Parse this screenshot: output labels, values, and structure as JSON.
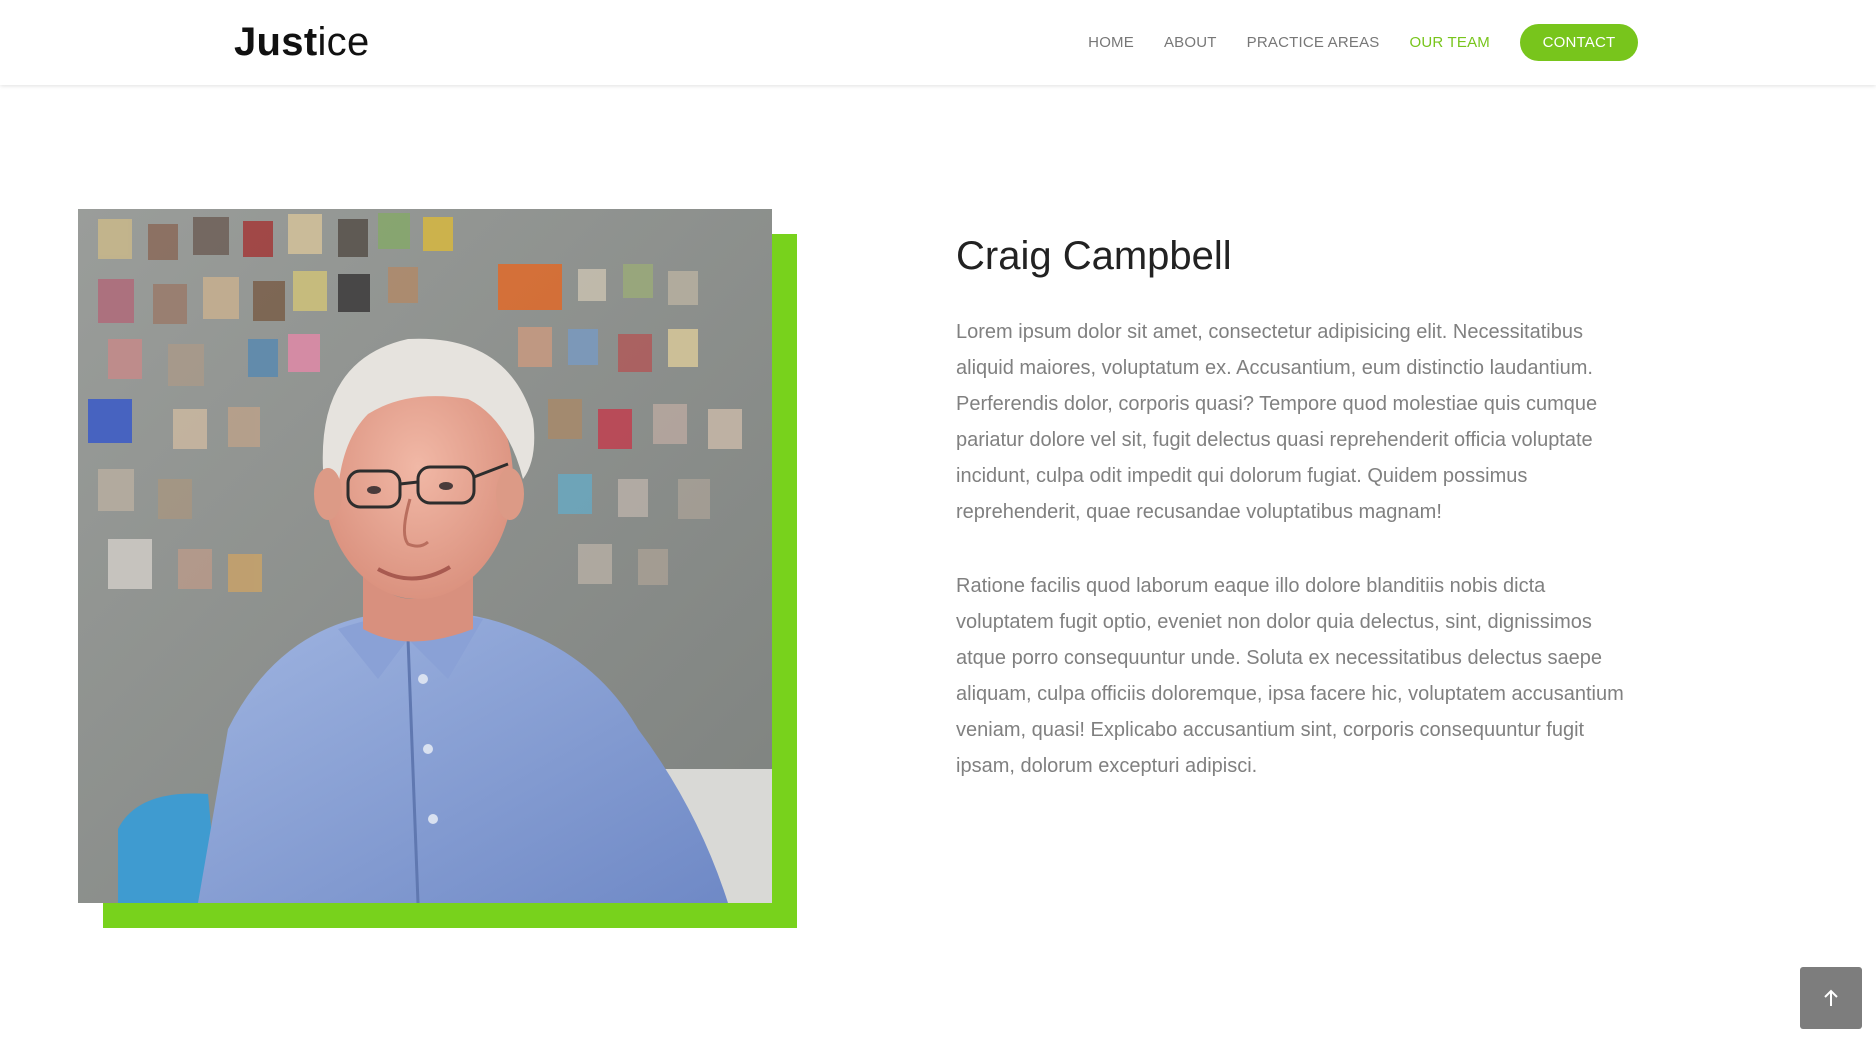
{
  "brand": {
    "logo_bold": "Just",
    "logo_light": "ice",
    "accent_color": "#78c51c"
  },
  "nav": {
    "items": [
      {
        "label": "HOME",
        "active": false
      },
      {
        "label": "ABOUT",
        "active": false
      },
      {
        "label": "PRACTICE AREAS",
        "active": false
      },
      {
        "label": "OUR TEAM",
        "active": true
      }
    ],
    "contact_label": "CONTACT"
  },
  "profile": {
    "name": "Craig Campbell",
    "paragraphs": [
      "Lorem ipsum dolor sit amet, consectetur adipisicing elit. Necessitatibus aliquid maiores, voluptatum ex. Accusantium, eum distinctio laudantium. Perferendis dolor, corporis quasi? Tempore quod molestiae quis cumque pariatur dolore vel sit, fugit delectus quasi reprehenderit officia voluptate incidunt, culpa odit impedit qui dolorum fugiat. Quidem possimus reprehenderit, quae recusandae voluptatibus magnam!",
      "Ratione facilis quod laborum eaque illo dolore blanditiis nobis dicta voluptatem fugit optio, eveniet non dolor quia delectus, sint, dignissimos atque porro consequuntur unde. Soluta ex necessitatibus delectus saepe aliquam, culpa officiis doloremque, ipsa facere hic, voluptatem accusantium veniam, quasi! Explicabo accusantium sint, corporis consequuntur fugit ipsam, dolorum excepturi adipisci."
    ]
  },
  "icons": {
    "back_to_top": "arrow-up-icon"
  }
}
